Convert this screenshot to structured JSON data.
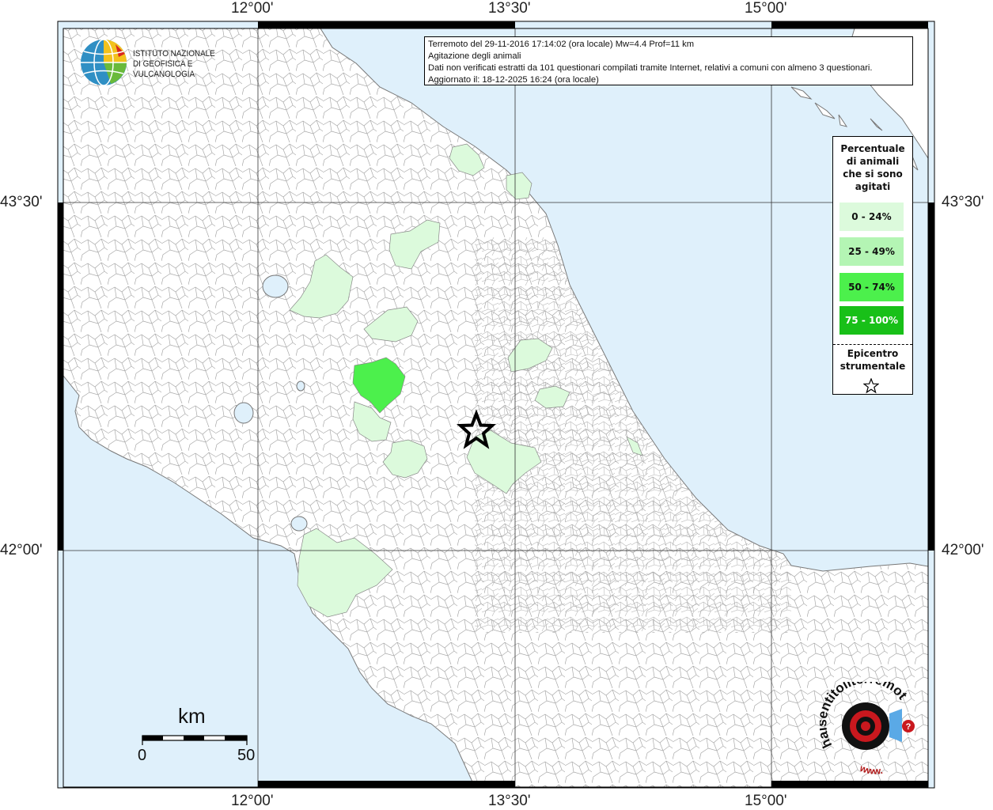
{
  "map": {
    "lon_labels": [
      "12°00'",
      "13°30'",
      "15°00'"
    ],
    "lat_labels": [
      "43°30'",
      "42°00'"
    ]
  },
  "info": {
    "line1": "Terremoto del 29-11-2016 17:14:02 (ora locale) Mw=4.4 Prof=11 km",
    "line2": "Agitazione degli animali",
    "line3": "Dati non verificati estratti da 101 questionari compilati tramite Internet, relativi a comuni con almeno 3 questionari.",
    "line4": "Aggiornato il: 18-12-2025 16:24 (ora locale)"
  },
  "legend": {
    "title_lines": [
      "Percentuale",
      "di animali",
      "che si sono",
      "agitati"
    ],
    "classes": [
      {
        "label": "0 - 24%",
        "color": "#dcfadc"
      },
      {
        "label": "25 - 49%",
        "color": "#b4f5b4"
      },
      {
        "label": "50 - 74%",
        "color": "#4cf04c"
      },
      {
        "label": "75 - 100%",
        "color": "#18c018"
      }
    ],
    "epicenter_lines": [
      "Epicentro",
      "strumentale"
    ]
  },
  "logo": {
    "ingv_line1": "ISTITUTO NAZIONALE",
    "ingv_line2": "DI GEOFISICA E VULCANOLOGIA",
    "hst_text": "haisentitoilterremoto.it",
    "hst_url": "www."
  },
  "scale": {
    "unit": "km",
    "min": "0",
    "max": "50"
  },
  "colors": {
    "sea": "#dff0fb",
    "land": "#ffffff",
    "border": "#8a8a8a"
  }
}
